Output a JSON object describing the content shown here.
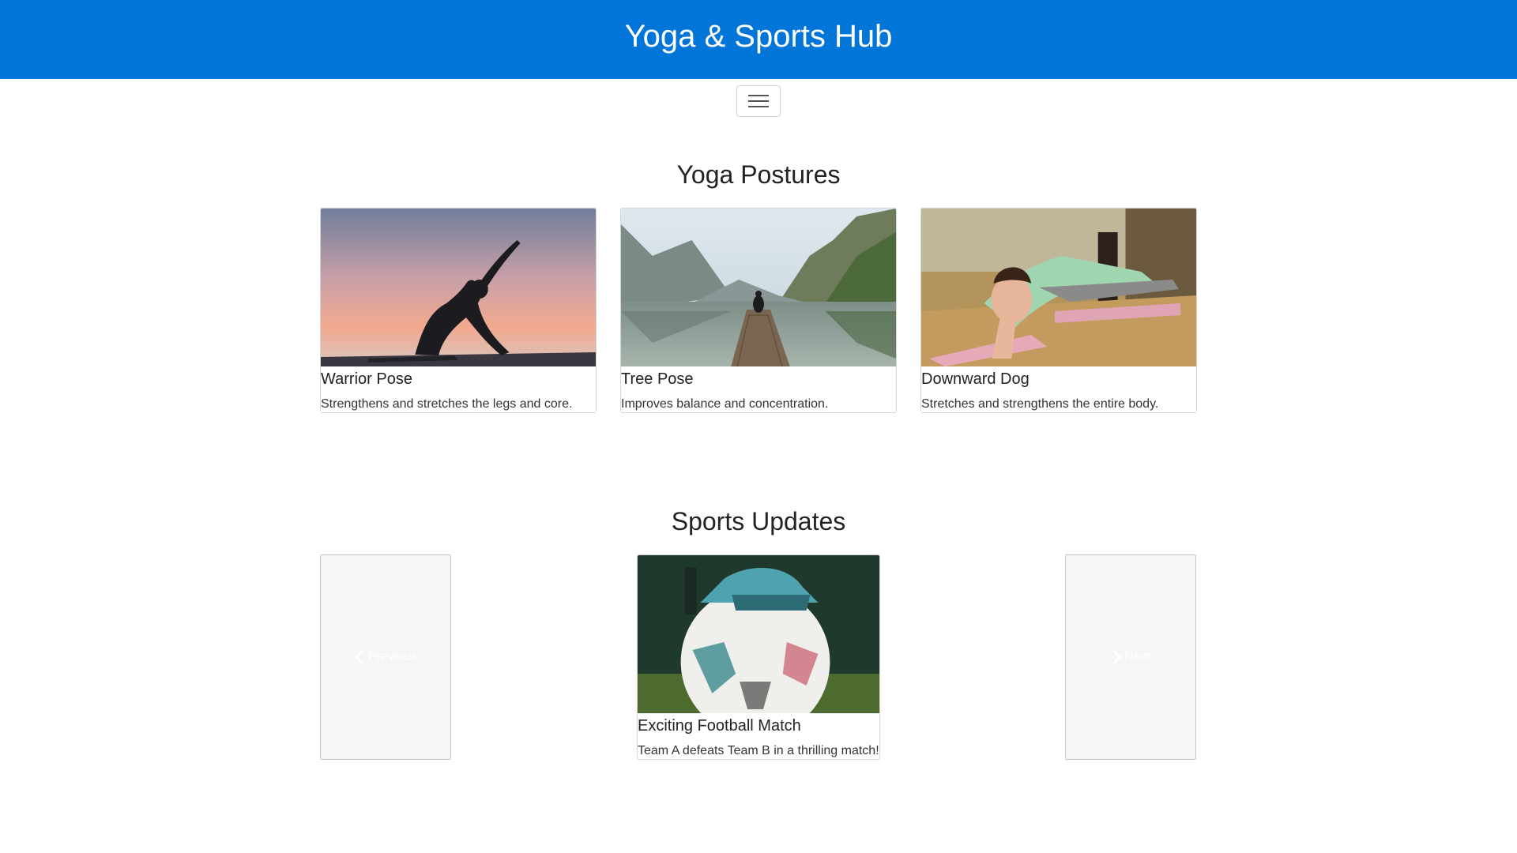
{
  "header": {
    "title": "Yoga & Sports Hub",
    "background": "#0275d8"
  },
  "nav": {
    "toggle_icon": "hamburger-menu-icon"
  },
  "yoga": {
    "heading": "Yoga Postures",
    "cards": [
      {
        "title": "Warrior Pose",
        "text": "Strengthens and stretches the legs and core.",
        "image": "sunset-yoga-silhouette"
      },
      {
        "title": "Tree Pose",
        "text": "Improves balance and concentration.",
        "image": "lake-dock-mountains"
      },
      {
        "title": "Downward Dog",
        "text": "Stretches and strengthens the entire body.",
        "image": "yoga-class-pose"
      }
    ]
  },
  "sports": {
    "heading": "Sports Updates",
    "prev_label": "Previous",
    "next_label": "Next",
    "slide": {
      "title": "Exciting Football Match",
      "text": "Team A defeats Team B in a thrilling match!",
      "image": "football-under-cleat"
    }
  }
}
